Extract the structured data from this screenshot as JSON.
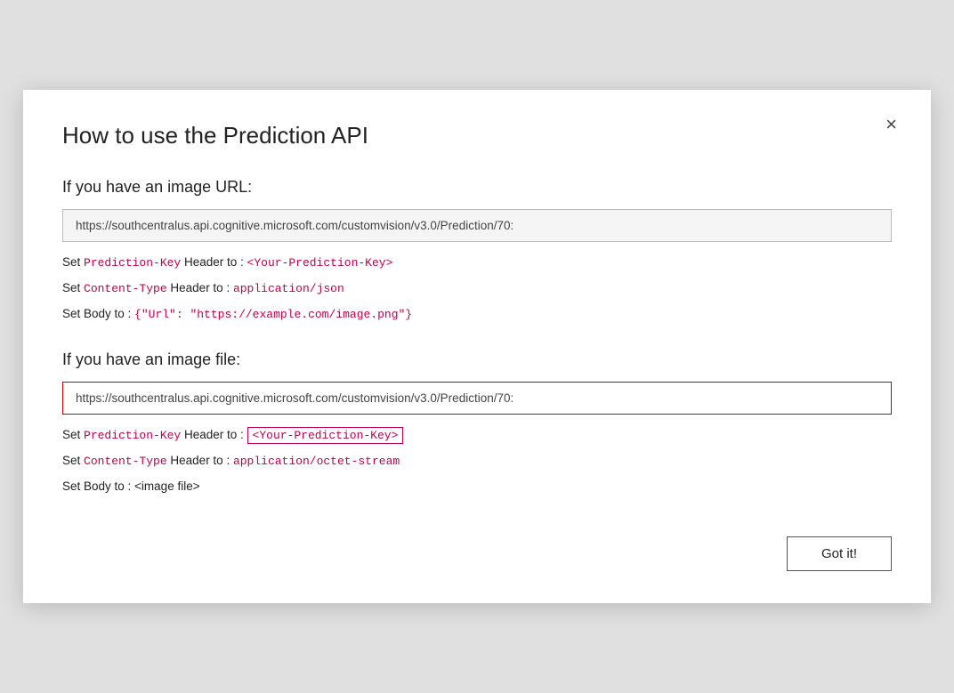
{
  "modal": {
    "title": "How to use the Prediction API",
    "close_label": "×",
    "url_section1": {
      "heading": "If you have an image URL:",
      "url": "https://southcentralus.api.cognitive.microsoft.com/customvision/v3.0/Prediction/70:",
      "line1_pre": "Set ",
      "line1_key": "Prediction-Key",
      "line1_mid": " Header to : ",
      "line1_val": "<Your-Prediction-Key>",
      "line2_pre": "Set ",
      "line2_key": "Content-Type",
      "line2_mid": " Header to : ",
      "line2_val": "application/json",
      "line3_pre": "Set Body to : ",
      "line3_val": "{\"Url\": \"https://example.com/image.png\"}"
    },
    "url_section2": {
      "heading": "If you have an image file:",
      "url": "https://southcentralus.api.cognitive.microsoft.com/customvision/v3.0/Prediction/70:",
      "line1_pre": "Set ",
      "line1_key": "Prediction-Key",
      "line1_mid": " Header to : ",
      "line1_val": "<Your-Prediction-Key>",
      "line2_pre": "Set ",
      "line2_key": "Content-Type",
      "line2_mid": " Header to : ",
      "line2_val": "application/octet-stream",
      "line3_pre": "Set Body to : <image file>"
    },
    "footer": {
      "got_it_label": "Got it!"
    }
  }
}
